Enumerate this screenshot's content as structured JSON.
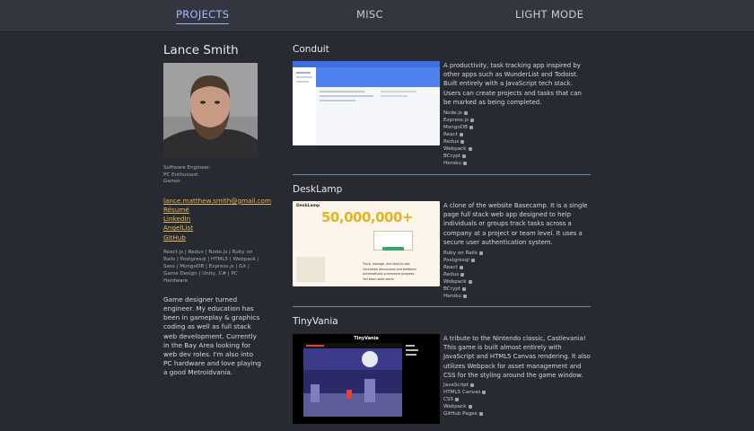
{
  "nav": {
    "projects": "PROJECTS",
    "misc": "MISC",
    "light_mode": "LIGHT MODE"
  },
  "profile": {
    "name": "Lance Smith",
    "tags": [
      "Software Engineer.",
      "PC Enthusiast.",
      "Gamer."
    ],
    "email": "lance.matthew.smith@gmail.com",
    "links": [
      "Résumé",
      "LinkedIn",
      "AngelList",
      "GitHub"
    ],
    "skills": "React.js | Redux | Node.js | Ruby on Rails | Postgresql | HTML5 | Webpack | Sass | MongoDB | Express.js | Git | Game Design | Unity, C# | PC Hardware",
    "bio": "Game designer turned engineer. My education has been in gameplay & graphics coding as well as full stack web development. Currently in the Bay Area looking for web dev roles. I'm also into PC hardware and love playing a good Metroidvania."
  },
  "projects": [
    {
      "title": "Conduit",
      "description": "A productivity, task tracking app inspired by other apps such as WunderList and Todoist. Built entirely with a JavaScript tech stack. Users can create projects and tasks that can be marked as being completed.",
      "stack": [
        "Node.js",
        "Express.js",
        "MongoDB",
        "React",
        "Redux",
        "Webpack",
        "BCrypt",
        "Heroku"
      ]
    },
    {
      "title": "DeskLamp",
      "description": "A clone of the website Basecamp. It is a single page full stack web app designed to help individuals or groups track tasks across a company at a project or team level. It uses a secure user authentication system.",
      "stack": [
        "Ruby on Rails",
        "Postgresql",
        "React",
        "Redux",
        "Webpack",
        "BCrypt",
        "Heroku"
      ],
      "shot_text": {
        "brand": "DeskLamp",
        "headline": "50,000,000+",
        "bullets": [
          "Track, manage, and start to-dos",
          "Centralize discussions and feedback",
          "Automatically summarize progress",
          "Get team-wide alerts"
        ]
      }
    },
    {
      "title": "TinyVania",
      "description": "A tribute to the Nintendo classic, Castlevania! This game is built almost entirely with JavaScript and HTML5 Canvas rendering. It also utilizes Webpack for asset management and CSS for the styling around the game window.",
      "stack": [
        "JavaScript",
        "HTML5 Canvas",
        "CSS",
        "Webpack",
        "GitHub Pages"
      ],
      "shot_text": {
        "title": "TinyVania"
      }
    }
  ]
}
